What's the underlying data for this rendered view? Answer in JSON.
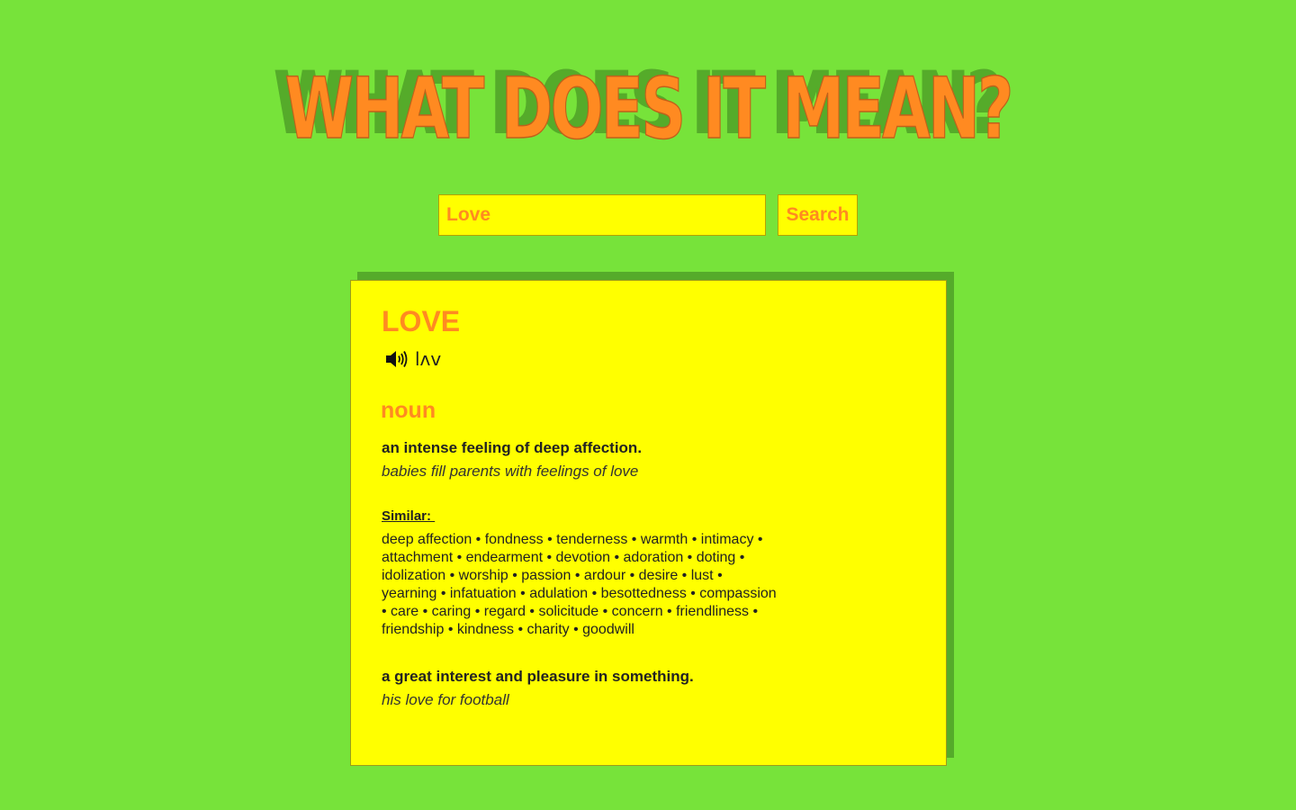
{
  "header": {
    "title": "WHAT DOES IT MEAN?"
  },
  "search": {
    "value": "Love",
    "button_label": "Search"
  },
  "result": {
    "word": "LOVE",
    "phonetic": "lʌv",
    "audio_icon": "speaker-icon",
    "part_of_speech": "noun",
    "definitions": [
      {
        "definition": "an intense feeling of deep affection.",
        "example": "babies fill parents with feelings of love",
        "similar_label": "Similar: ",
        "similar_lines": [
          "deep affection • fondness • tenderness • warmth • intimacy •",
          "attachment • endearment • devotion • adoration • doting •",
          "idolization • worship • passion • ardour • desire • lust •",
          "yearning • infatuation • adulation • besottedness • compassion",
          "• care • caring • regard • solicitude • concern • friendliness •",
          "friendship • kindness • charity • goodwill"
        ]
      },
      {
        "definition": "a great interest and pleasure in something.",
        "example": "his love for football"
      }
    ]
  },
  "colors": {
    "background": "#77e33a",
    "shadow_green": "#55ab2a",
    "card_yellow": "#ffff00",
    "accent_orange": "#ff8a21",
    "text_dark": "#222222"
  }
}
